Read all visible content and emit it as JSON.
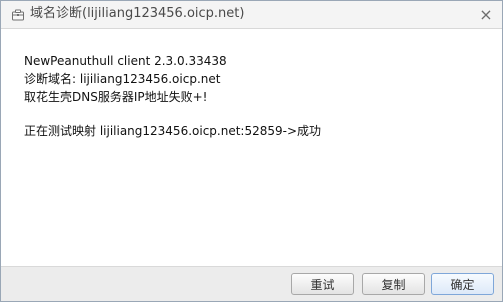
{
  "window": {
    "title": "域名诊断(lijiliang123456.oicp.net)",
    "close_symbol": "×",
    "title_icon_name": "toolbox-icon"
  },
  "content": {
    "lines": [
      "NewPeanuthull client 2.3.0.33438",
      "诊断域名: lijiliang123456.oicp.net",
      "取花生壳DNS服务器IP地址失败+!",
      "正在测试映射 lijiliang123456.oicp.net:52859->成功"
    ]
  },
  "footer": {
    "buttons": {
      "retry": "重试",
      "copy": "复制",
      "ok": "确定"
    }
  },
  "colors": {
    "title_bg": "#f4f4f4",
    "footer_bg": "#ececec",
    "border": "#9aa7b6",
    "ok_button_border": "#7fa7d9"
  }
}
